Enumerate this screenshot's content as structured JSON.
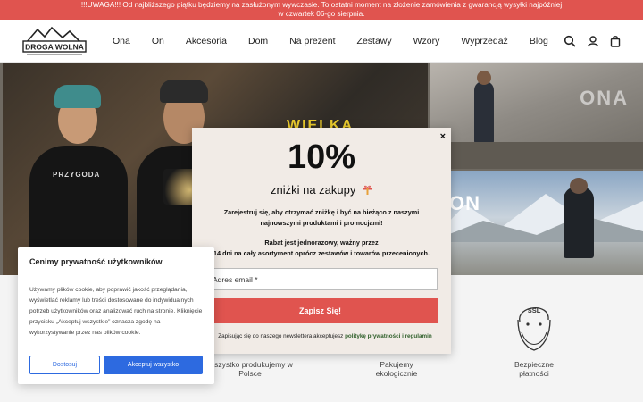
{
  "announcement": {
    "text": "!!!UWAGA!!! Od najbliższego piątku będziemy na zasłużonym wywczasie. To ostatni moment na złożenie zamówienia z gwarancją wysyłki najpóźniej w czwartek 06-go sierpnia."
  },
  "header": {
    "logo_text": "DROGA WOLNA",
    "nav": [
      "Ona",
      "On",
      "Akcesoria",
      "Dom",
      "Na prezent",
      "Zestawy",
      "Wzory",
      "Wyprzedaż",
      "Blog"
    ],
    "icons": [
      "search-icon",
      "account-icon",
      "cart-icon"
    ]
  },
  "hero": {
    "main_print": "PRZYGODA",
    "main_overlay": "WIELKA",
    "tile_top_label": "ONA",
    "tile_bottom_label": "ON"
  },
  "features": {
    "items": [
      {
        "icon": "poland-icon",
        "label": "Wszystko produkujemy w Polsce"
      },
      {
        "icon": "eco-package-icon",
        "label": "Pakujemy ekologicznie"
      },
      {
        "icon": "ssl-icon",
        "label": "Bezpieczne płatności",
        "badge": "SSL"
      }
    ]
  },
  "newsletter": {
    "headline": "10%",
    "subheadline": "zniżki na zakupy",
    "text1": "Zarejestruj się, aby otrzymać zniżkę i być na bieżąco z naszymi najnowszymi produktami i promocjami!",
    "text2a": "Rabat jest jednorazowy, ważny przez",
    "text2b": "14 dni na cały asortyment oprócz zestawów i towarów przecenionych.",
    "email_placeholder": "Adres email *",
    "submit_label": "Zapisz Się!",
    "consent_prefix": "Zapisując się do naszego newslettera akceptujesz",
    "consent_link": "politykę prywatności i regulamin",
    "close_label": "×"
  },
  "cookie": {
    "title": "Cenimy prywatność użytkowników",
    "body": "Używamy plików cookie, aby poprawić jakość przeglądania, wyświetlać reklamy lub treści dostosowane do indywidualnych potrzeb użytkowników oraz analizować ruch na stronie. Kliknięcie przycisku „Akceptuj wszystkie” oznacza zgodę na wykorzystywanie przez nas plików cookie.",
    "reject_label": "Dostosuj",
    "accept_label": "Akceptuj wszystko"
  },
  "colors": {
    "accent": "#e0544f",
    "cookie_accent": "#2d6ae0",
    "modal_bg": "#f1ebe6"
  }
}
